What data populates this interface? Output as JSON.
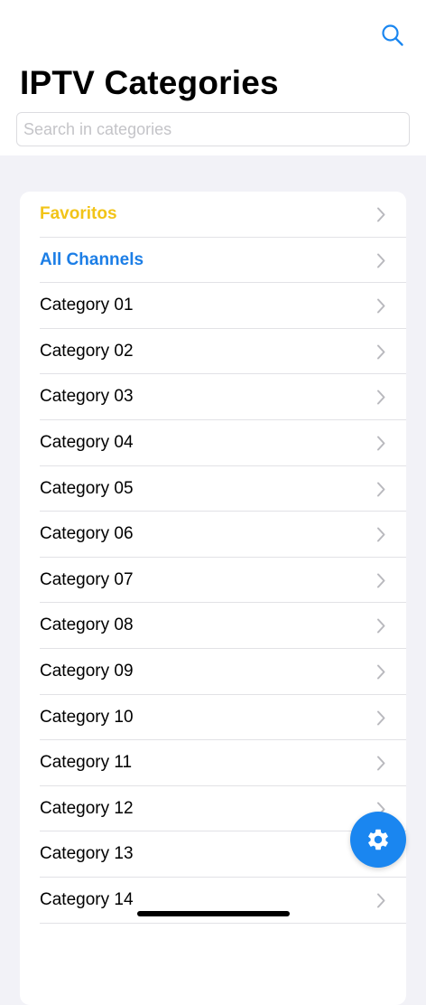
{
  "header": {
    "title": "IPTV Categories",
    "search_icon": "search-icon"
  },
  "search": {
    "placeholder": "Search in categories",
    "value": ""
  },
  "list": {
    "chevron_icon": "chevron-right-icon",
    "items": [
      {
        "label": "Favoritos",
        "style": "fav",
        "color": "#f2c418"
      },
      {
        "label": "All Channels",
        "style": "all",
        "color": "#1c7ee6"
      },
      {
        "label": "Category 01",
        "style": "normal"
      },
      {
        "label": "Category 02",
        "style": "normal"
      },
      {
        "label": "Category 03",
        "style": "normal"
      },
      {
        "label": "Category 04",
        "style": "normal"
      },
      {
        "label": "Category 05",
        "style": "normal"
      },
      {
        "label": "Category 06",
        "style": "normal"
      },
      {
        "label": "Category 07",
        "style": "normal"
      },
      {
        "label": "Category 08",
        "style": "normal"
      },
      {
        "label": "Category 09",
        "style": "normal"
      },
      {
        "label": "Category 10",
        "style": "normal"
      },
      {
        "label": "Category 11",
        "style": "normal"
      },
      {
        "label": "Category 12",
        "style": "normal"
      },
      {
        "label": "Category 13",
        "style": "normal"
      },
      {
        "label": "Category 14",
        "style": "normal"
      }
    ]
  },
  "fab": {
    "icon": "gear-icon",
    "color": "#1a86f0"
  },
  "colors": {
    "accent": "#1a86f0",
    "favorite": "#f2c418",
    "background": "#f2f2f7"
  }
}
